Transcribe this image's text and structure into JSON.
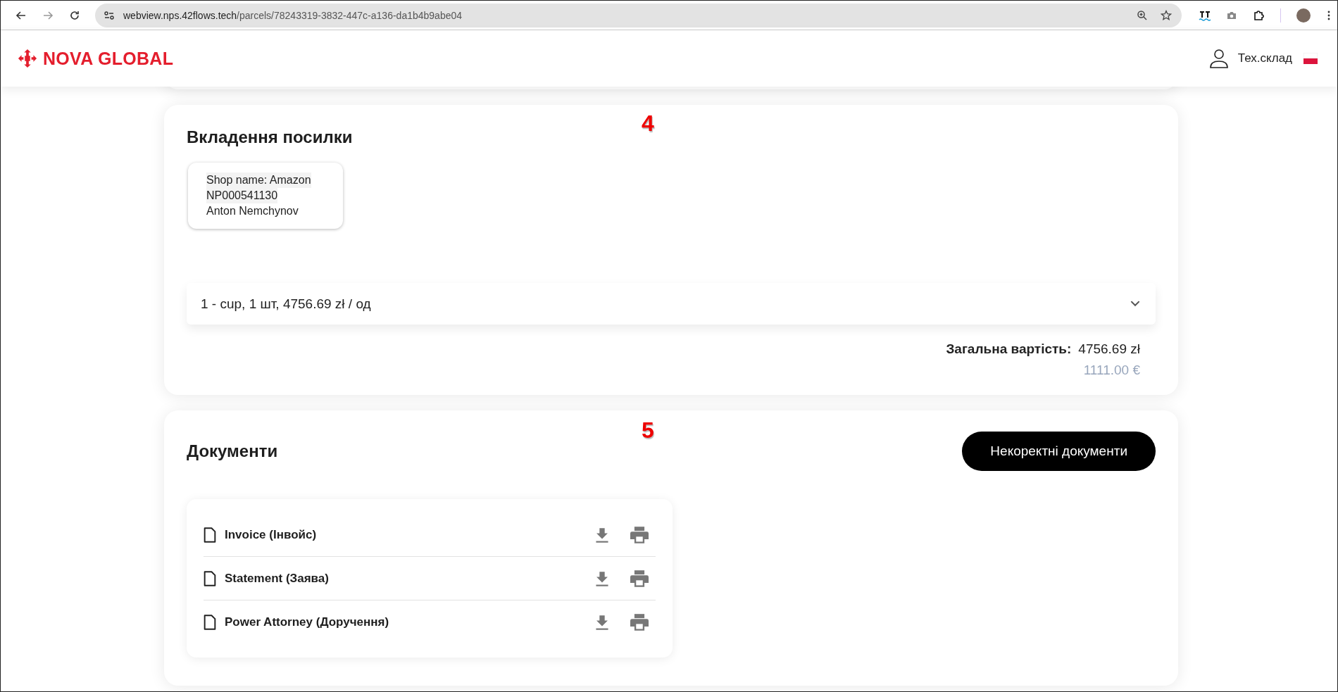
{
  "browser": {
    "url_host": "webview.nps.42flows.tech",
    "url_path": "/parcels/78243319-3832-447c-a136-da1b4b9abe04"
  },
  "header": {
    "logo": "NOVA GLOBAL",
    "user": "Тех.склад"
  },
  "contents_section": {
    "marker": "4",
    "title": "Вкладення посилки",
    "shop_card": [
      "Shop name: Amazon",
      "NP000541130",
      "Anton Nemchynov"
    ],
    "items": [
      {
        "label": "1 - cup, 1 шт, 4756.69 zł / од",
        "expanded": false
      }
    ],
    "total_label": "Загальна вартість:",
    "total_value": "4756.69 zł",
    "total_eur": "1111.00 €"
  },
  "documents_section": {
    "marker": "5",
    "title": "Документи",
    "button": "Некоректні документи",
    "documents": [
      {
        "name": "Invoice (Інвойс)"
      },
      {
        "name": "Statement (Заява)"
      },
      {
        "name": "Power Attorney (Доручення)"
      }
    ]
  }
}
